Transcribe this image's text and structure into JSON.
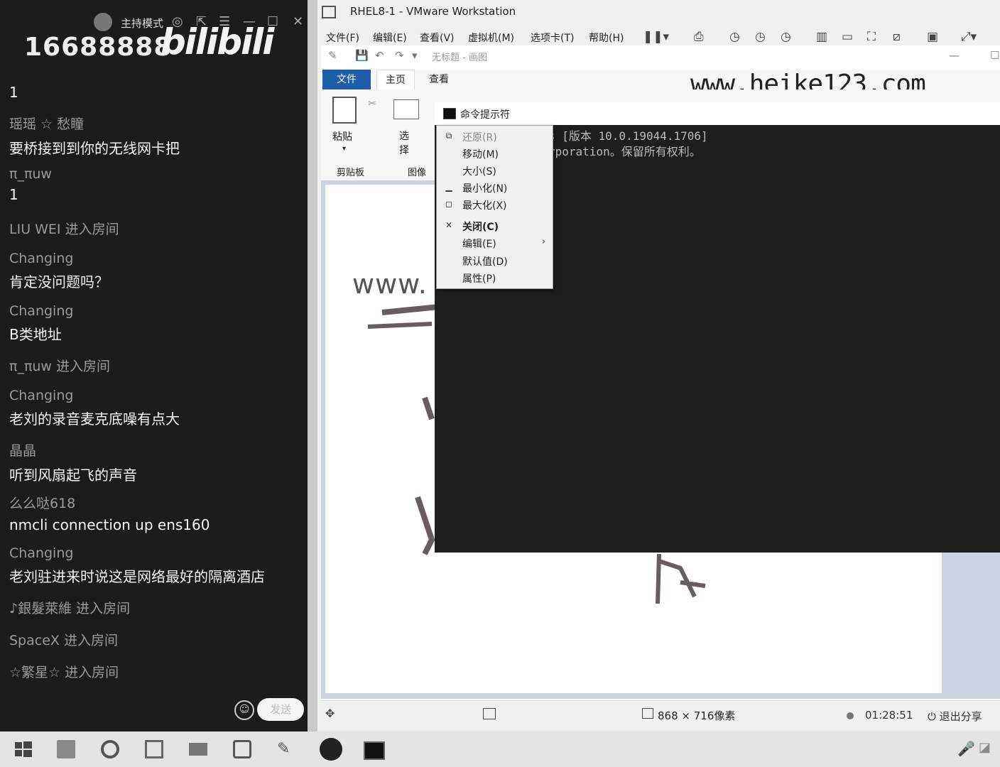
{
  "chat": {
    "mode_label": "主持模式",
    "room_id": "16688888",
    "logo": "bilibili",
    "messages": [
      {
        "user": "",
        "text": "1"
      },
      {
        "user": "瑶瑶 ☆ 愁瞳",
        "text": "要桥接到到你的无线网卡把"
      },
      {
        "user": "π_πuw",
        "text": "1"
      },
      {
        "user": "LIU WEI 进入房间",
        "text": ""
      },
      {
        "user": "Changing",
        "text": "肯定没问题吗？"
      },
      {
        "user": "Changing",
        "text": "B类地址"
      },
      {
        "user": "π_πuw 进入房间",
        "text": ""
      },
      {
        "user": "Changing",
        "text": "老刘的录音麦克底噪有点大"
      },
      {
        "user": "晶晶",
        "text": "听到风扇起飞的声音"
      },
      {
        "user": "么么哒618",
        "text": "nmcli connection up ens160"
      },
      {
        "user": "Changing",
        "text": "老刘驻进来时说这是网络最好的隔离酒店"
      },
      {
        "user": "♪銀髮萊維 进入房间",
        "text": ""
      },
      {
        "user": "SpaceX 进入房间",
        "text": ""
      },
      {
        "user": "☆繁星☆ 进入房间",
        "text": ""
      }
    ],
    "send_label": "发送"
  },
  "vmware": {
    "title": "RHEL8-1 - VMware Workstation",
    "menu": [
      "文件(F)",
      "编辑(E)",
      "查看(V)",
      "虚拟机(M)",
      "选项卡(T)",
      "帮助(H)"
    ]
  },
  "paint": {
    "title": "无标题 - 画图",
    "tabs": [
      "文件",
      "主页",
      "查看"
    ],
    "watermark": "www.heike123.com",
    "ribbon": {
      "paste": "粘贴",
      "select": "选择",
      "clipboard": "剪贴板",
      "image": "图像"
    },
    "canvas_text": "www.",
    "dims": "868 × 716像素"
  },
  "cmd": {
    "title": "命令提示符",
    "line1": "s [版本 10.0.19044.1706]",
    "line2": "rporation。保留所有权利。"
  },
  "context_menu": [
    {
      "label": "还原(R)",
      "glyph": "restore",
      "disabled": true
    },
    {
      "label": "移动(M)",
      "glyph": "",
      "disabled": false
    },
    {
      "label": "大小(S)",
      "glyph": "",
      "disabled": false
    },
    {
      "label": "最小化(N)",
      "glyph": "minimize",
      "disabled": false
    },
    {
      "label": "最大化(X)",
      "glyph": "maximize",
      "disabled": false
    },
    {
      "label": "关闭(C)",
      "glyph": "close",
      "bold": true
    },
    {
      "label": "编辑(E)",
      "glyph": "",
      "submenu": true
    },
    {
      "label": "默认值(D)",
      "glyph": ""
    },
    {
      "label": "属性(P)",
      "glyph": ""
    }
  ],
  "recording": {
    "time": "01:28:51",
    "exit_label": "退出分享"
  }
}
